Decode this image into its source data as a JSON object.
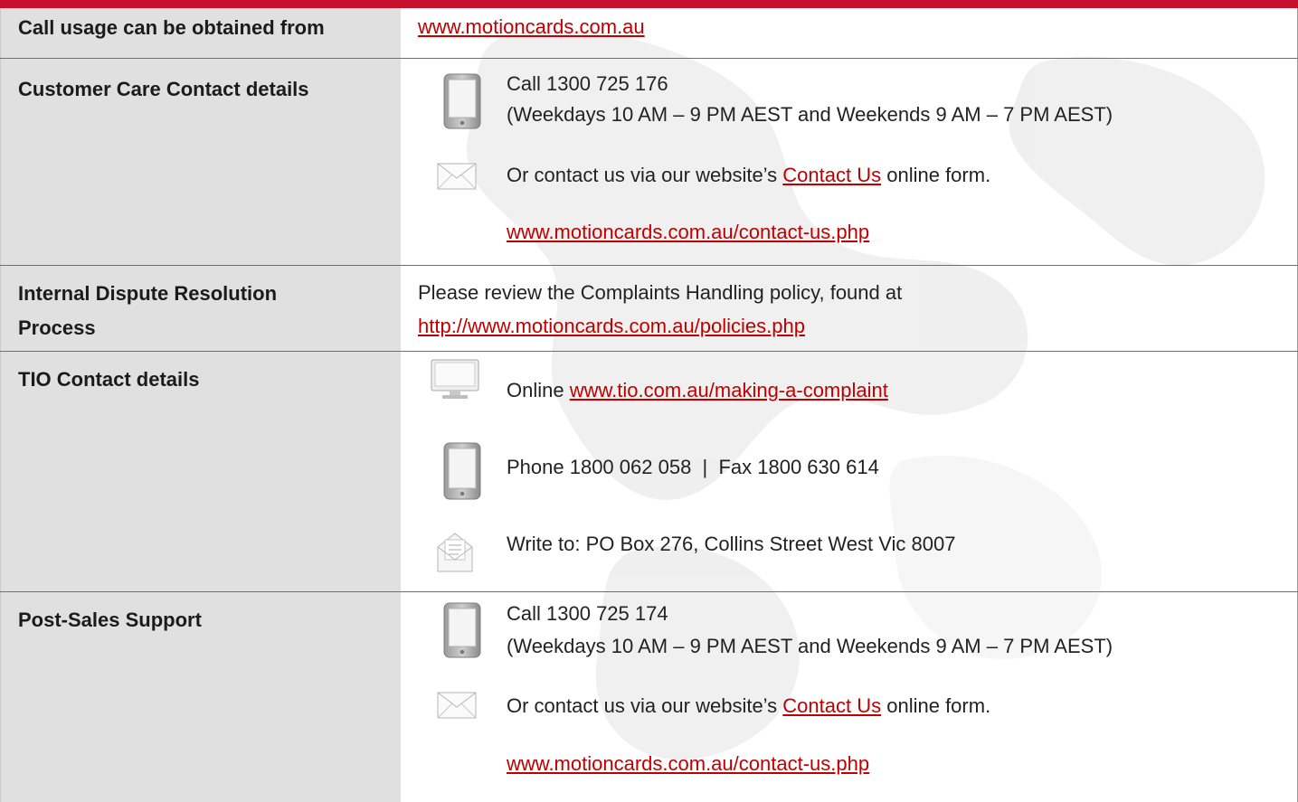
{
  "rows": {
    "call_usage": {
      "label": "Call usage can be obtained from",
      "link": "www.motioncards.com.au"
    },
    "customer_care": {
      "label": "Customer Care Contact details",
      "call": "Call 1300 725 176",
      "hours": "(Weekdays 10 AM – 9 PM AEST and Weekends 9 AM – 7 PM AEST)",
      "contact_pre": "Or contact us via our website’s ",
      "contact_link": "Contact Us",
      "contact_post": " online form.",
      "url": "www.motioncards.com.au/contact-us.php"
    },
    "dispute": {
      "label_line1": "Internal Dispute Resolution",
      "label_line2": "Process",
      "text": "Please review the Complaints Handling policy, found at",
      "url": "http://www.motioncards.com.au/policies.php"
    },
    "tio": {
      "label": "TIO Contact details",
      "online_label": "Online ",
      "online_url": "www.tio.com.au/making-a-complaint",
      "phone": "Phone 1800 062 058  |  Fax 1800 630 614",
      "write": "Write to: PO Box 276, Collins Street West Vic 8007"
    },
    "post_sales": {
      "label": "Post-Sales Support",
      "call": "Call 1300 725 174",
      "hours": "(Weekdays 10 AM – 9 PM AEST and Weekends 9 AM – 7 PM AEST)",
      "contact_pre": "Or contact us via our website’s ",
      "contact_link": "Contact Us",
      "contact_post": " online form.",
      "url": "www.motioncards.com.au/contact-us.php"
    }
  },
  "colors": {
    "accent": "#c8102e",
    "link": "#c00000",
    "label_bg": "#d7d7d7"
  },
  "icons": [
    "mobile-phone-icon",
    "envelope-icon",
    "computer-monitor-icon",
    "open-letter-icon"
  ]
}
